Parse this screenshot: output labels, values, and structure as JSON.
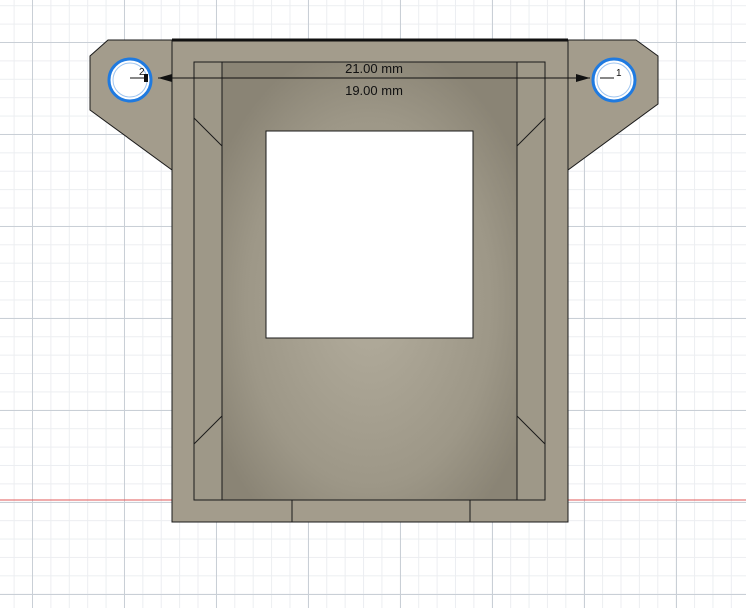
{
  "colors": {
    "body_fill": "#a39c8c",
    "inner_dark": "#8e8879",
    "cutout_fill": "#ffffff",
    "edge_line": "#1a1a1a",
    "axis_red": "#e05a5a",
    "marker_ring": "#1f7ae0"
  },
  "dimensions": {
    "outer": "21.00 mm",
    "inner": "19.00 mm"
  },
  "markers": {
    "left_label": "2",
    "right_label": "1"
  }
}
